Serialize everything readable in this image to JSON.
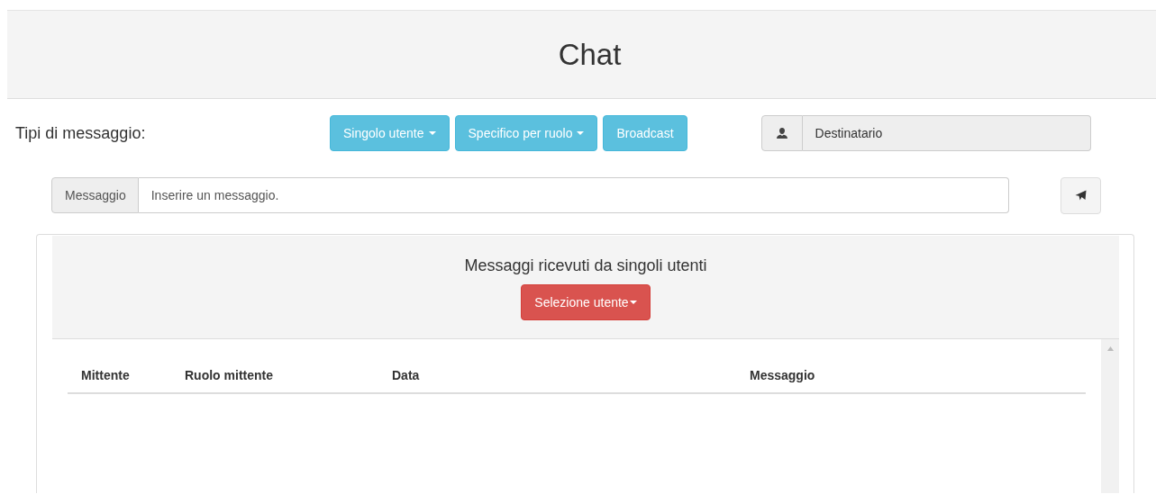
{
  "header": {
    "title": "Chat"
  },
  "message_types": {
    "label": "Tipi di messaggio:",
    "buttons": [
      {
        "label": "Singolo utente",
        "kind": "dropdown"
      },
      {
        "label": "Specifico per ruolo",
        "kind": "dropdown"
      },
      {
        "label": "Broadcast",
        "kind": "button"
      }
    ]
  },
  "recipient": {
    "value": "Destinatario",
    "disabled": true
  },
  "message": {
    "addon": "Messaggio",
    "placeholder": "Inserire un messaggio."
  },
  "panel": {
    "title": "Messaggi ricevuti da singoli utenti",
    "user_select": "Selezione utente",
    "table": {
      "columns": [
        "Mittente",
        "Ruolo mittente",
        "Data",
        "Messaggio"
      ]
    }
  }
}
